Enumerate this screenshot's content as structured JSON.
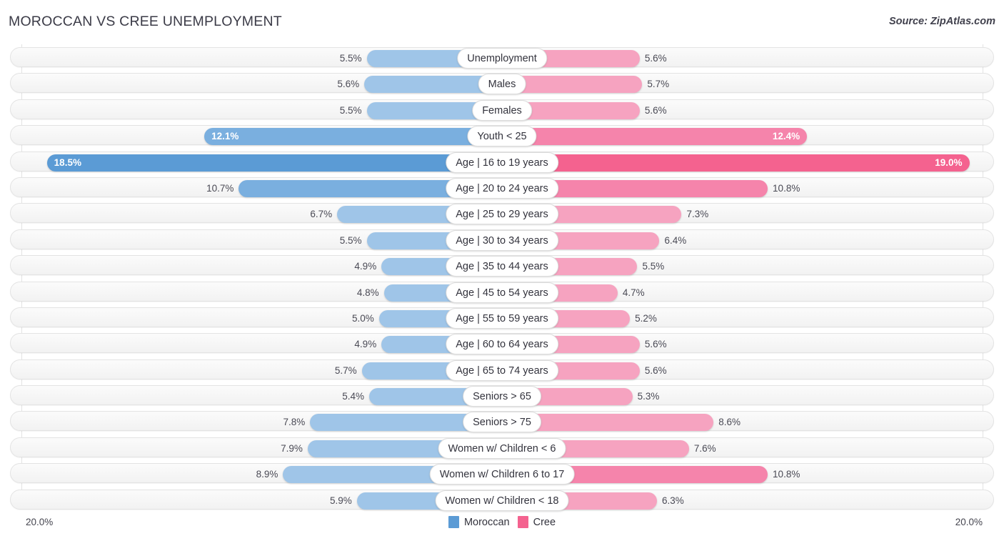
{
  "header": {
    "title": "MOROCCAN VS CREE UNEMPLOYMENT",
    "source": "Source: ZipAtlas.com"
  },
  "footer": {
    "axis_min_left": "20.0%",
    "axis_min_right": "20.0%",
    "legend": [
      {
        "label": "Moroccan",
        "color": "#5b9bd5",
        "name": "legend-swatch-moroccan"
      },
      {
        "label": "Cree",
        "color": "#f4628f",
        "name": "legend-swatch-cree"
      }
    ]
  },
  "colors": {
    "moroccan_light": "#9fc5e8",
    "moroccan_mid": "#7aafdf",
    "moroccan_dark": "#5b9bd5",
    "cree_light": "#f6a3c0",
    "cree_mid": "#f584ab",
    "cree_dark": "#f4628f",
    "track": "#f6f6f6",
    "track_border": "#e3e3e3"
  },
  "chart_data": {
    "type": "bar",
    "subtype": "diverging-bar",
    "title": "MOROCCAN VS CREE UNEMPLOYMENT",
    "xlabel": "",
    "ylabel": "",
    "axis_max": 20.0,
    "axis_unit": "%",
    "xlim": [
      20.0,
      20.0
    ],
    "grid": false,
    "legend_position": "bottom-center",
    "series": [
      {
        "name": "Moroccan",
        "side": "left",
        "color": "#9fc5e8",
        "values": [
          5.5,
          5.6,
          5.5,
          12.1,
          18.5,
          10.7,
          6.7,
          5.5,
          4.9,
          4.8,
          5.0,
          4.9,
          5.7,
          5.4,
          7.8,
          7.9,
          8.9,
          5.9
        ],
        "labels": [
          "5.5%",
          "5.6%",
          "5.5%",
          "12.1%",
          "18.5%",
          "10.7%",
          "6.7%",
          "5.5%",
          "4.9%",
          "4.8%",
          "5.0%",
          "4.9%",
          "5.7%",
          "5.4%",
          "7.8%",
          "7.9%",
          "8.9%",
          "5.9%"
        ]
      },
      {
        "name": "Cree",
        "side": "right",
        "color": "#f6a3c0",
        "values": [
          5.6,
          5.7,
          5.6,
          12.4,
          19.0,
          10.8,
          7.3,
          6.4,
          5.5,
          4.7,
          5.2,
          5.6,
          5.6,
          5.3,
          8.6,
          7.6,
          10.8,
          6.3
        ],
        "labels": [
          "5.6%",
          "5.7%",
          "5.6%",
          "12.4%",
          "19.0%",
          "10.8%",
          "7.3%",
          "6.4%",
          "5.5%",
          "4.7%",
          "5.2%",
          "5.6%",
          "5.6%",
          "5.3%",
          "8.6%",
          "7.6%",
          "10.8%",
          "6.3%"
        ]
      }
    ],
    "categories": [
      "Unemployment",
      "Males",
      "Females",
      "Youth < 25",
      "Age | 16 to 19 years",
      "Age | 20 to 24 years",
      "Age | 25 to 29 years",
      "Age | 30 to 34 years",
      "Age | 35 to 44 years",
      "Age | 45 to 54 years",
      "Age | 55 to 59 years",
      "Age | 60 to 64 years",
      "Age | 65 to 74 years",
      "Seniors > 65",
      "Seniors > 75",
      "Women w/ Children < 6",
      "Women w/ Children 6 to 17",
      "Women w/ Children < 18"
    ],
    "rows": [
      {
        "category": "Unemployment",
        "left_value": 5.5,
        "left_label": "5.5%",
        "left_color": "#9fc5e8",
        "left_inside": false,
        "right_value": 5.6,
        "right_label": "5.6%",
        "right_color": "#f6a3c0",
        "right_inside": false
      },
      {
        "category": "Males",
        "left_value": 5.6,
        "left_label": "5.6%",
        "left_color": "#9fc5e8",
        "left_inside": false,
        "right_value": 5.7,
        "right_label": "5.7%",
        "right_color": "#f6a3c0",
        "right_inside": false
      },
      {
        "category": "Females",
        "left_value": 5.5,
        "left_label": "5.5%",
        "left_color": "#9fc5e8",
        "left_inside": false,
        "right_value": 5.6,
        "right_label": "5.6%",
        "right_color": "#f6a3c0",
        "right_inside": false
      },
      {
        "category": "Youth < 25",
        "left_value": 12.1,
        "left_label": "12.1%",
        "left_color": "#7aafdf",
        "left_inside": true,
        "right_value": 12.4,
        "right_label": "12.4%",
        "right_color": "#f584ab",
        "right_inside": true
      },
      {
        "category": "Age | 16 to 19 years",
        "left_value": 18.5,
        "left_label": "18.5%",
        "left_color": "#5b9bd5",
        "left_inside": true,
        "right_value": 19.0,
        "right_label": "19.0%",
        "right_color": "#f4628f",
        "right_inside": true
      },
      {
        "category": "Age | 20 to 24 years",
        "left_value": 10.7,
        "left_label": "10.7%",
        "left_color": "#7aafdf",
        "left_inside": false,
        "right_value": 10.8,
        "right_label": "10.8%",
        "right_color": "#f584ab",
        "right_inside": false
      },
      {
        "category": "Age | 25 to 29 years",
        "left_value": 6.7,
        "left_label": "6.7%",
        "left_color": "#9fc5e8",
        "left_inside": false,
        "right_value": 7.3,
        "right_label": "7.3%",
        "right_color": "#f6a3c0",
        "right_inside": false
      },
      {
        "category": "Age | 30 to 34 years",
        "left_value": 5.5,
        "left_label": "5.5%",
        "left_color": "#9fc5e8",
        "left_inside": false,
        "right_value": 6.4,
        "right_label": "6.4%",
        "right_color": "#f6a3c0",
        "right_inside": false
      },
      {
        "category": "Age | 35 to 44 years",
        "left_value": 4.9,
        "left_label": "4.9%",
        "left_color": "#9fc5e8",
        "left_inside": false,
        "right_value": 5.5,
        "right_label": "5.5%",
        "right_color": "#f6a3c0",
        "right_inside": false
      },
      {
        "category": "Age | 45 to 54 years",
        "left_value": 4.8,
        "left_label": "4.8%",
        "left_color": "#9fc5e8",
        "left_inside": false,
        "right_value": 4.7,
        "right_label": "4.7%",
        "right_color": "#f6a3c0",
        "right_inside": false
      },
      {
        "category": "Age | 55 to 59 years",
        "left_value": 5.0,
        "left_label": "5.0%",
        "left_color": "#9fc5e8",
        "left_inside": false,
        "right_value": 5.2,
        "right_label": "5.2%",
        "right_color": "#f6a3c0",
        "right_inside": false
      },
      {
        "category": "Age | 60 to 64 years",
        "left_value": 4.9,
        "left_label": "4.9%",
        "left_color": "#9fc5e8",
        "left_inside": false,
        "right_value": 5.6,
        "right_label": "5.6%",
        "right_color": "#f6a3c0",
        "right_inside": false
      },
      {
        "category": "Age | 65 to 74 years",
        "left_value": 5.7,
        "left_label": "5.7%",
        "left_color": "#9fc5e8",
        "left_inside": false,
        "right_value": 5.6,
        "right_label": "5.6%",
        "right_color": "#f6a3c0",
        "right_inside": false
      },
      {
        "category": "Seniors > 65",
        "left_value": 5.4,
        "left_label": "5.4%",
        "left_color": "#9fc5e8",
        "left_inside": false,
        "right_value": 5.3,
        "right_label": "5.3%",
        "right_color": "#f6a3c0",
        "right_inside": false
      },
      {
        "category": "Seniors > 75",
        "left_value": 7.8,
        "left_label": "7.8%",
        "left_color": "#9fc5e8",
        "left_inside": false,
        "right_value": 8.6,
        "right_label": "8.6%",
        "right_color": "#f6a3c0",
        "right_inside": false
      },
      {
        "category": "Women w/ Children < 6",
        "left_value": 7.9,
        "left_label": "7.9%",
        "left_color": "#9fc5e8",
        "left_inside": false,
        "right_value": 7.6,
        "right_label": "7.6%",
        "right_color": "#f6a3c0",
        "right_inside": false
      },
      {
        "category": "Women w/ Children 6 to 17",
        "left_value": 8.9,
        "left_label": "8.9%",
        "left_color": "#9fc5e8",
        "left_inside": false,
        "right_value": 10.8,
        "right_label": "10.8%",
        "right_color": "#f584ab",
        "right_inside": false
      },
      {
        "category": "Women w/ Children < 18",
        "left_value": 5.9,
        "left_label": "5.9%",
        "left_color": "#9fc5e8",
        "left_inside": false,
        "right_value": 6.3,
        "right_label": "6.3%",
        "right_color": "#f6a3c0",
        "right_inside": false
      }
    ]
  }
}
